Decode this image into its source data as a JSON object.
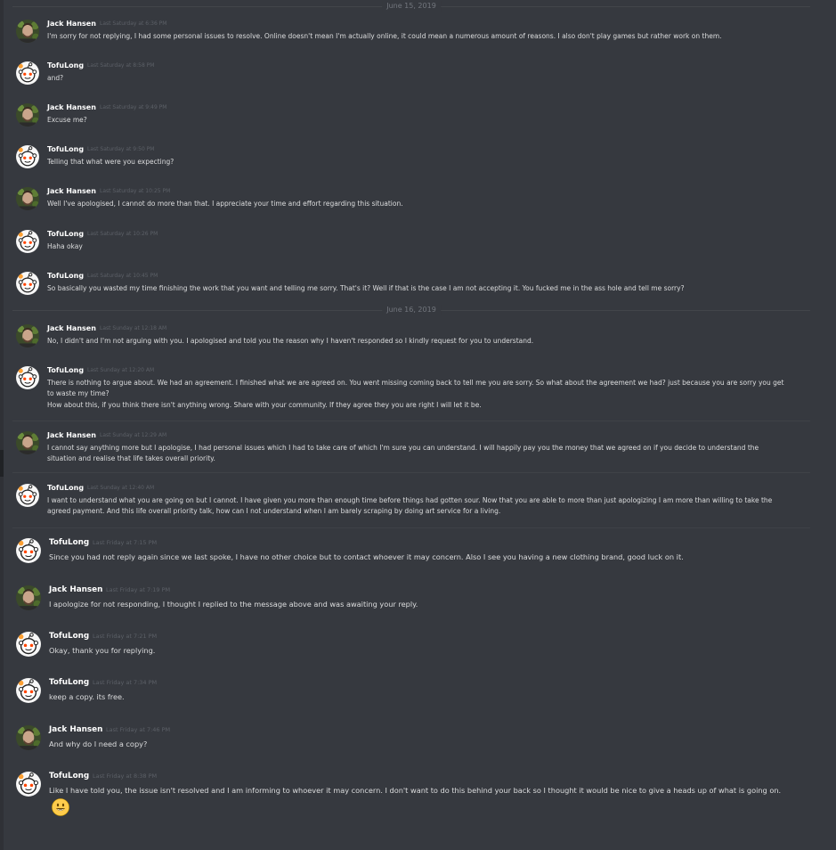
{
  "dividers": [
    "June 15, 2019",
    "June 16, 2019"
  ],
  "messages": [
    {
      "user": "Jack Hansen",
      "time": "Last Saturday at 6:36 PM",
      "text": "I'm sorry for not replying, I had some personal issues to resolve. Online doesn't mean I'm actually online, it could mean a numerous amount of reasons. I also don't play games but rather work on them."
    },
    {
      "user": "TofuLong",
      "time": "Last Saturday at 8:58 PM",
      "text": "and?"
    },
    {
      "user": "Jack Hansen",
      "time": "Last Saturday at 9:49 PM",
      "text": "Excuse me?"
    },
    {
      "user": "TofuLong",
      "time": "Last Saturday at 9:50 PM",
      "text": "Telling that what were you expecting?"
    },
    {
      "user": "Jack Hansen",
      "time": "Last Saturday at 10:25 PM",
      "text": "Well I've apologised, I cannot do more than that. I appreciate your time and effort regarding this situation."
    },
    {
      "user": "TofuLong",
      "time": "Last Saturday at 10:26 PM",
      "text": "Haha okay"
    },
    {
      "user": "TofuLong",
      "time": "Last Saturday at 10:45 PM",
      "text": "So basically you wasted my time finishing the work that you want and telling me sorry. That's it? Well if that is the case I am not accepting it. You fucked me in the ass hole and tell me sorry?"
    },
    {
      "user": "Jack Hansen",
      "time": "Last Sunday at 12:18 AM",
      "text": "No, I didn't and I'm not arguing with you. I apologised and told you the reason why I haven't responded so I kindly request for you to understand."
    },
    {
      "user": "TofuLong",
      "time": "Last Sunday at 12:20 AM",
      "text": "There is nothing to argue about. We had an agreement. I finished what we are agreed on. You went missing coming back to tell me you are sorry. So what about the agreement we had? just because you are sorry you get to waste my time?",
      "text2": "How about this, if you think there isn't anything wrong. Share with your community. If they agree they you are right I will let it be."
    },
    {
      "user": "Jack Hansen",
      "time": "Last Sunday at 12:29 AM",
      "text": "I cannot say anything more but I apologise, I had personal issues which I had to take care of which I'm sure you can understand. I will happily pay you the money that we agreed on if you decide to understand the situation and realise that life takes overall priority."
    },
    {
      "user": "TofuLong",
      "time": "Last Sunday at 12:40 AM",
      "text": "I want to understand what you are going on but I cannot. I have given you more than enough time before things had gotten sour. Now that you are able to more than just apologizing I am more than willing to take the agreed payment. And this life overall priority talk, how can I not understand when I am barely scraping by doing art service for a living."
    },
    {
      "user": "TofuLong",
      "time": "Last Friday at 7:15 PM",
      "text": "Since you had not reply again since we last spoke, I have no other choice but to contact whoever it may concern.  Also I see you having a new clothing brand, good luck on it."
    },
    {
      "user": "Jack Hansen",
      "time": "Last Friday at 7:19 PM",
      "text": "I apologize for not responding, I thought I replied to the message above and was awaiting your reply."
    },
    {
      "user": "TofuLong",
      "time": "Last Friday at 7:21 PM",
      "text": "Okay, thank you for replying."
    },
    {
      "user": "TofuLong",
      "time": "Last Friday at 7:34 PM",
      "text": "keep a copy. its free."
    },
    {
      "user": "Jack Hansen",
      "time": "Last Friday at 7:46 PM",
      "text": "And why do I need a copy?"
    },
    {
      "user": "TofuLong",
      "time": "Last Friday at 8:38 PM",
      "text": "Like I have told you, the issue isn't resolved and I am informing to whoever it may concern. I don't want to do this behind your back so I thought it would be nice to give a heads up of what is going on."
    }
  ],
  "icons": {
    "jack_avatar": "jack-hansen-avatar",
    "tofu_avatar": "reddit-snoo-avatar",
    "emoji": "smiley-emoji"
  }
}
